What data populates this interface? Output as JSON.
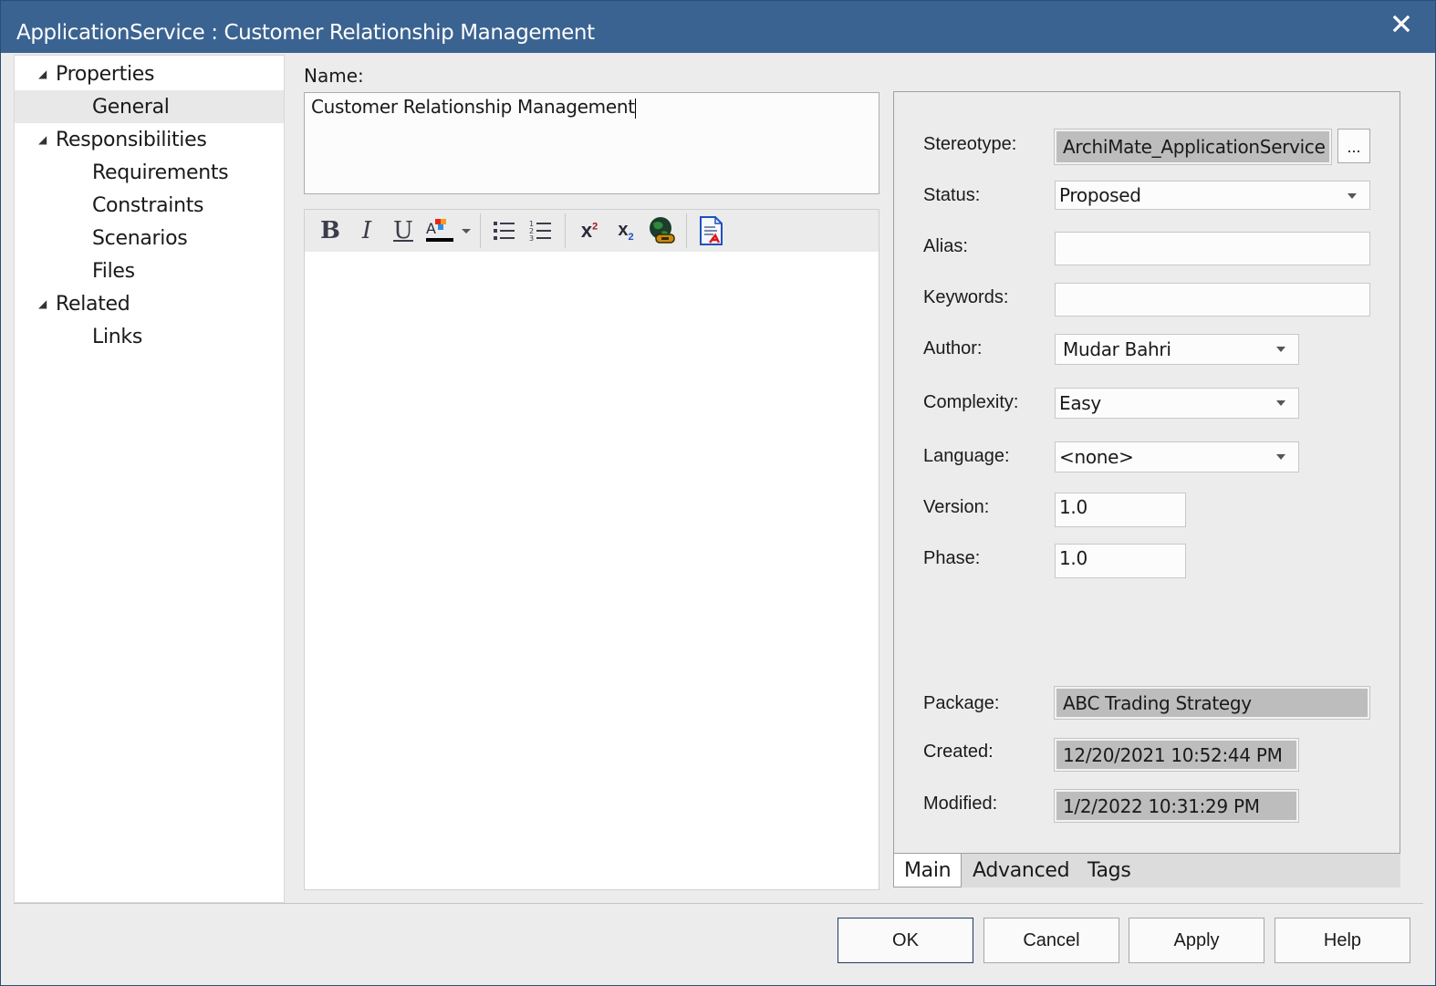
{
  "window": {
    "title": "ApplicationService : Customer Relationship Management",
    "close_icon": "close-icon"
  },
  "tree": {
    "items": [
      {
        "label": "Properties",
        "level": 0,
        "expanded": true,
        "selected": false
      },
      {
        "label": "General",
        "level": 1,
        "selected": true
      },
      {
        "label": "Responsibilities",
        "level": 0,
        "expanded": true,
        "selected": false
      },
      {
        "label": "Requirements",
        "level": 1,
        "selected": false
      },
      {
        "label": "Constraints",
        "level": 1,
        "selected": false
      },
      {
        "label": "Scenarios",
        "level": 1,
        "selected": false
      },
      {
        "label": "Files",
        "level": 1,
        "selected": false
      },
      {
        "label": "Related",
        "level": 0,
        "expanded": true,
        "selected": false
      },
      {
        "label": "Links",
        "level": 1,
        "selected": false
      }
    ]
  },
  "name": {
    "label": "Name:",
    "value": "Customer Relationship Management"
  },
  "toolbar": {
    "buttons": [
      "bold-icon",
      "italic-icon",
      "underline-icon",
      "font-color-icon",
      "dropdown-arrow-icon",
      "bullet-list-icon",
      "numbered-list-icon",
      "superscript-icon",
      "subscript-icon",
      "hyperlink-icon",
      "document-icon"
    ],
    "bold_glyph": "B",
    "italic_glyph": "I",
    "underline_glyph": "U",
    "font_color_glyph": "A",
    "superscript_glyph": "x",
    "superscript_num": "2",
    "subscript_glyph": "x",
    "subscript_num": "2"
  },
  "properties": {
    "stereotype": {
      "label": "Stereotype:",
      "value": "ArchiMate_ApplicationService",
      "button": "..."
    },
    "status": {
      "label": "Status:",
      "value": "Proposed"
    },
    "alias": {
      "label": "Alias:",
      "value": ""
    },
    "keywords": {
      "label": "Keywords:",
      "value": ""
    },
    "author": {
      "label": "Author:",
      "value": "Mudar Bahri"
    },
    "complexity": {
      "label": "Complexity:",
      "value": "Easy"
    },
    "language": {
      "label": "Language:",
      "value": "<none>"
    },
    "version": {
      "label": "Version:",
      "value": "1.0"
    },
    "phase": {
      "label": "Phase:",
      "value": "1.0"
    },
    "package": {
      "label": "Package:",
      "value": "ABC Trading Strategy"
    },
    "created": {
      "label": "Created:",
      "value": "12/20/2021 10:52:44 PM"
    },
    "modified": {
      "label": "Modified:",
      "value": "1/2/2022 10:31:29 PM"
    }
  },
  "tabs": [
    {
      "label": "Main",
      "active": true
    },
    {
      "label": "Advanced",
      "active": false
    },
    {
      "label": "Tags",
      "active": false
    }
  ],
  "buttons": {
    "ok": "OK",
    "cancel": "Cancel",
    "apply": "Apply",
    "help": "Help"
  },
  "colors": {
    "titlebar": "#3a6391",
    "readonly_field": "#bdbdbd",
    "selected_tree_item": "#e8e8e8"
  }
}
